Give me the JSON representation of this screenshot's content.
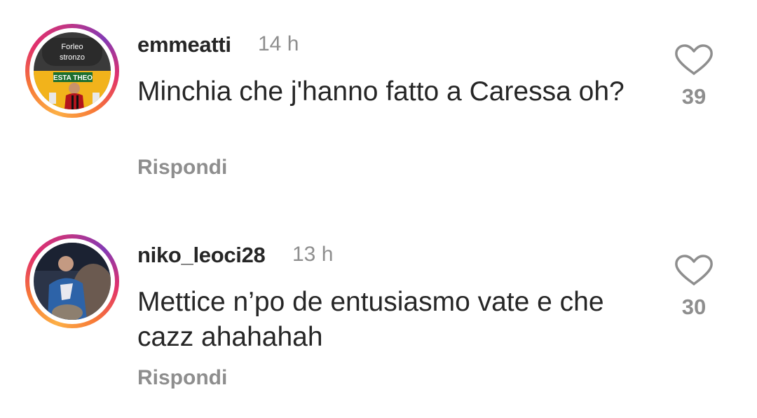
{
  "comments": [
    {
      "username": "emmeatti",
      "time": "14 h",
      "text": "Minchia che j'hanno fatto a Caressa oh?",
      "reply_label": "Rispondi",
      "likes": "39",
      "avatar": {
        "badge_line1": "Forleo",
        "badge_line2": "stronzo",
        "sign_text": "ESTA THEO"
      }
    },
    {
      "username": "niko_leoci28",
      "time": "13 h",
      "text": "Mettice n’po de entusiasmo vate e che cazz ahahahah",
      "reply_label": "Rispondi",
      "likes": "30"
    }
  ],
  "colors": {
    "text": "#262626",
    "muted": "#8e8e8e",
    "heart_outline": "#8e8e8e",
    "story_ring": [
      "#fcaf45",
      "#f77737",
      "#e1306c",
      "#c13584",
      "#833ab4"
    ]
  },
  "icons": {
    "like": "heart-outline-icon"
  }
}
